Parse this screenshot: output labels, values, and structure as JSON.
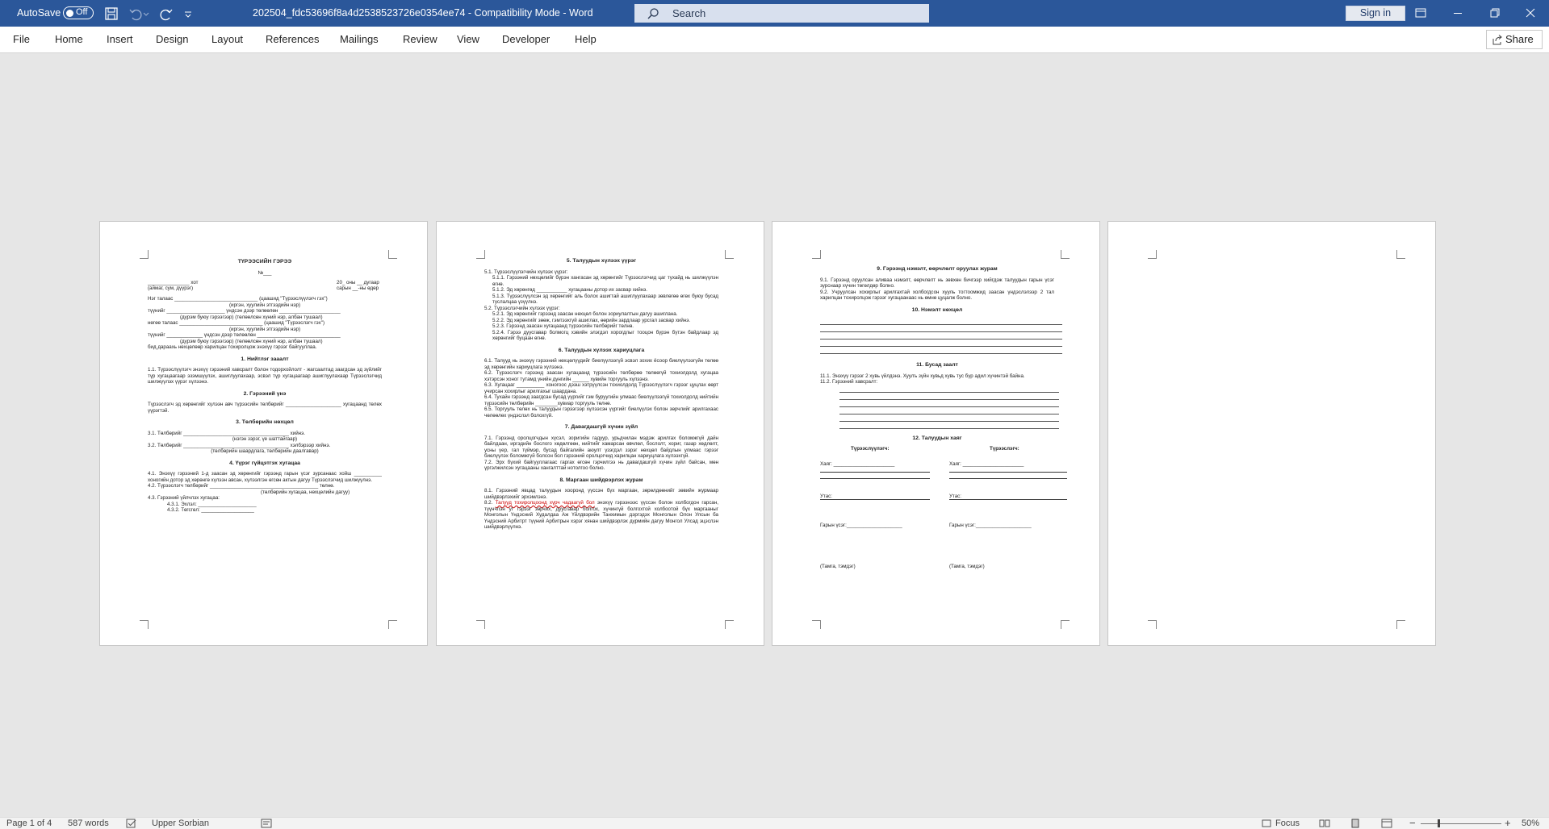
{
  "titlebar": {
    "autosave_label": "AutoSave",
    "autosave_state": "Off",
    "document_title": "202504_fdc53696f8a4d2538523726e0354ee74  -  Compatibility Mode  -  Word",
    "search_placeholder": "Search",
    "signin_label": "Sign in"
  },
  "menu": {
    "file": "File",
    "home": "Home",
    "insert": "Insert",
    "design": "Design",
    "layout": "Layout",
    "references": "References",
    "mailings": "Mailings",
    "review": "Review",
    "view": "View",
    "developer": "Developer",
    "help": "Help",
    "share": "Share"
  },
  "page1": {
    "title": "ТҮРЭЭСИЙН ГЭРЭЭ",
    "number_line": "№___",
    "city_line": "_______________ хот",
    "date_line": "20_ оны __ дугаар",
    "city_sub": "(аймаг, сум, дүүрэг)",
    "date_sub": "сарын __-ны өдөр",
    "party1": "Нэг талаас ______________________________ (цаашид \"Түрээслүүлэгч гэх\")",
    "party1_sub": "(иргэн, хуулийн этгээдийн нэр)",
    "party1_b": "түүнийг _____________________ үндсэн дээр төлөөлөн ______________________",
    "party1_b_sub": "(дүрэм буюу гэрээгээр)                                           (төлөөлсөн хүний нэр, албан тушаал)",
    "party2": "нөгөө талаас ______________________________ (цаашид \"Түрээслэгч гэх\")",
    "party2_sub": "(иргэн, хуулийн этгээдийн нэр)",
    "party2_b": "түүнийг _____________ үндсэн дээр төлөөлөн ______________________________",
    "party2_b_sub": "(дүрэм буюу гэрээгээр)                                           (төлөөлсөн хүний нэр, албан тушаал)",
    "intro": "бид дараахь нөхцөлөөр харилцан тохиролцож энэхүү гэрээг байгууллаа.",
    "h1": "1. Нийтлэг зааалт",
    "p1": "1.1. Түрээслүүлэгч энэхүү гэрээний хавсралт болон тодорхойлолт - жагсаалтад заагдсан эд зүйлийг түр хугацаагаар эзэмшүүлэх, ашиглуулахаар, эсвэл түр хугацаагаар ашиглуулахаар Түрээслэгчид шилжүүлэх үүрэг хүлээнэ.",
    "h2": "2. Гэрээний үнэ",
    "p2": "Түрээслэгч эд хөрөнгийг хүлээн авч түрээсийн төлбөрийг ____________________ хугацаанд төлөх үүрэгтэй.",
    "h3": "3. Төлбөрийн нөхцөл",
    "p3_1": "3.1. Төлбөрийг ______________________________________ хийнэ.",
    "p3_1_sub": "(нэгэн зэрэг, үе шаттайгаар)",
    "p3_2": "3.2. Төлбөрийг ______________________________________ хэлбэрээр хийнэ.",
    "p3_2_sub": "(төлбөрийн шаардлага, төлбөрийн даалгавар)",
    "h4": "4. Үүрэг гүйцэтгэх хугацаа",
    "p4_1": "4.1. Энэхүү гэрээний 1-д заасан эд хөрөнгийг гэрээнд гарын үсэг зурсанаас хойш __________ хоногийн дотор эд хөрөнгө хүлээн авсан, хүлээлгэн өгсөн актын дагуу Түрээслэгчид шилжүүлнэ.",
    "p4_2": "4.2. Түрээслэгч төлбөрийг _______________________________________ төлнө.",
    "p4_2_sub": "(төлбөрийн хугацаа, нөхцөлийн дагуу)",
    "p4_3": "4.3. Гэрээний үйлчлэх хугацаа:",
    "p4_3_1": "4.3.1. Эхлэл: _____________________",
    "p4_3_2": "4.3.2. Төгсгөл: ___________________"
  },
  "page2": {
    "h5": "5. Талуудын хүлээх үүрэг",
    "p5_1": "5.1. Түрээслүүлэгчийн хүлээх үүрэг:",
    "p5_1_1": "5.1.1. Гэрээний нөхцөлийг бүрэн хангасан эд хөрөнгийг Түрээслэгчид цаг тухайд нь шилжүүлэн өгнө.",
    "p5_1_2": "5.1.2. Эд хөрөнгөд ___________ хугацааны дотор их засвар хийнэ.",
    "p5_1_3": "5.1.3. Түрээслүүлсэн эд хөрөнгийг аль болох ашигтай ашиглуулахаар зөвлөгөө өгөх буюу бусад туслалцаа үзүүлнэ.",
    "p5_2": "5.2. Түрээслэгчийн хүлээх үүрэг:",
    "p5_2_1": "5.2.1. Эд хөрөнгийг гэрээнд заасан нөхцөл болон зориулалтын дагуу ашиглана.",
    "p5_2_2": "5.2.2. Эд хөрөнгийг зөөж, гэмтээхгүй ашиглах, өөрийн зардлаар урсгал засвар хийнэ.",
    "p5_2_3": "5.2.3. Гэрээнд заасан хугацаанд түрээсийн төлбөрийг төлнө.",
    "p5_2_4": "5.2.4. Гэрээ дуусгавар болмогц хэвийн элэгдэл хорогдлыг тооцон бүрэн бүтэн байдлаар эд хөрөнгийг буцаан өгнө.",
    "h6": "6. Талуудын хүлээх хариуцлага",
    "p6_1": "6.1. Талууд нь энэхүү гэрээний нөхцөлүүдийг биелүүлээгүй эсвэл зохих ёсоор биелүүлээгүйн төлөө эд хөрөнгийн хариуцлага хүлээнэ.",
    "p6_2": "6.2. Түрээслэгч гэрээнд заасан хугацаанд түрээсийн төлбөрөө төлөөгүй тохиолдолд хугацаа хэтэрсэн хоног тутамд үнийн дүнгийн ______ хувийн торгууль хүлээнэ.",
    "p6_3": "6.3. Хугацааг __________ хоногоос дээш хэтрүүлсэн тохиолдолд Түрээслүүлэгч гэрээг цуцлах өөрт учирсан хохирлыг арилгахыг шаардана.",
    "p6_4": "6.4. Тухайн гэрээнд заагдсан бусад үүргийг гэм буруугийн улмаас биелүүлээгүй тохиолдолд нийтийн түрээсийн төлбөрийн ________хувиар торгууль төлнө.",
    "p6_5": "6.5. Торгууль төлөх нь талуудын гэрээгээр хүлээсэн үүргийг биелүүлэх болон зөрчлийг арилгахаас чөлөөлөх үндэслэл болохгүй.",
    "h7": "7. Давагдашгүй хүчин зүйл",
    "p7_1": "7.1. Гэрээнд оролцогчдын хүсэл, зоригийн гадуур, урьдчилан мэдэж арилгах боломжгүй дайн байлдаан, иргэдийн бослого хөдөлгөөн, нийтийг хамарсан өвчлөл, бослолт, хориг, газар хөдлөлт, усны үер, гал түймэр, бусад байгалийн аюулт үзэгдэл зэрэг нөхцөл байдлын улмаас гэрээг биелүүлэх боломжгүй болсон бол гэрээний оролцогчид харилцан хариуцлага хүлээхгүй.",
    "p7_2": "7.2. Эрх бүхий байгууллагаас гаргах өгсөн гэрчилгээ нь давагдашгүй хүчин зүйл байсан, мөн үргэлжилсэн хугацааны хангалттай нотолгоо болно.",
    "h8": "8. Маргаан шийдвэрлэх журам",
    "p8_1": "8.1. Гэрээний явцад талуудын хооронд үүссэн бүх маргаан, зөрөлдөөнийг зөвийн журмаар шийдвэрлэхийг эрхэмлэнэ.",
    "p8_2_prefix": "8.2. ",
    "p8_2_err": "Талууд тохиролцоонд хүрч чадаагүй бол",
    "p8_2_rest": " энэхүү гэрээнээс үүссэн болон холбогдон гарсан, түүнчлэн уг гэрээг зөрчих, дуусгавар болгох, хүчингүй болгохтой холбоотой бүх маргааныг Монголын Үндэсний Худалдаа Аж Үйлдвэрийн Танхимын дэргэдэх Монголын Олон Улсын ба Үндэсний Арбитрт түүний Арбитрын хэрэг хянан шийдвэрлэх дүрмийн дагуу Монгол Улсад эцэслэн шийдвэрлүүлнэ."
  },
  "page3": {
    "h9": "9. Гэрээнд нэмэлт, өөрчлөлт оруулах журам",
    "p9_1": "9.1. Гэрээнд оруулсан аливаа нэмэлт, өөрчлөлт нь зөвхөн бичгээр хийгдэж талуудын гарын үсэг зурснаар хүчин төгөлдөр болно.",
    "p9_2": "9.2. Учруулсан хохирлыг арилгахтай холбогдсон хууль тогтоомжид заасан үндэслэлээр 2 тал харилцан тохиролцож гэрээг хугацаанаас нь өмнө цуцалж болно.",
    "h10": "10. Нэмэлт нөхцөл",
    "h11": "11. Бусад заалт",
    "p11_1": "11.1. Энэхүү гэрээг 2 хувь үйлдэнэ. Хуулъ зүйн хувьд хувь тус бүр адил хүчинтэй байна.",
    "p11_2": "11.2. Гэрээний хавсралт:",
    "h12": "12. Талуудын хаяг",
    "lessor": "Түрээслүүлэгч:",
    "lessee": "Түрээслэгч:",
    "address": "Хаяг: ______________________",
    "phone": "Утас:",
    "sign": "Гарын үсэг:____________________",
    "stamp": "(Тамга, тэмдэг)"
  },
  "statusbar": {
    "page": "Page 1 of 4",
    "words": "587 words",
    "language": "Upper Sorbian",
    "focus": "Focus",
    "zoom": "50%"
  },
  "colors": {
    "titlebar": "#2b579a",
    "canvas": "#e6e6e6"
  }
}
